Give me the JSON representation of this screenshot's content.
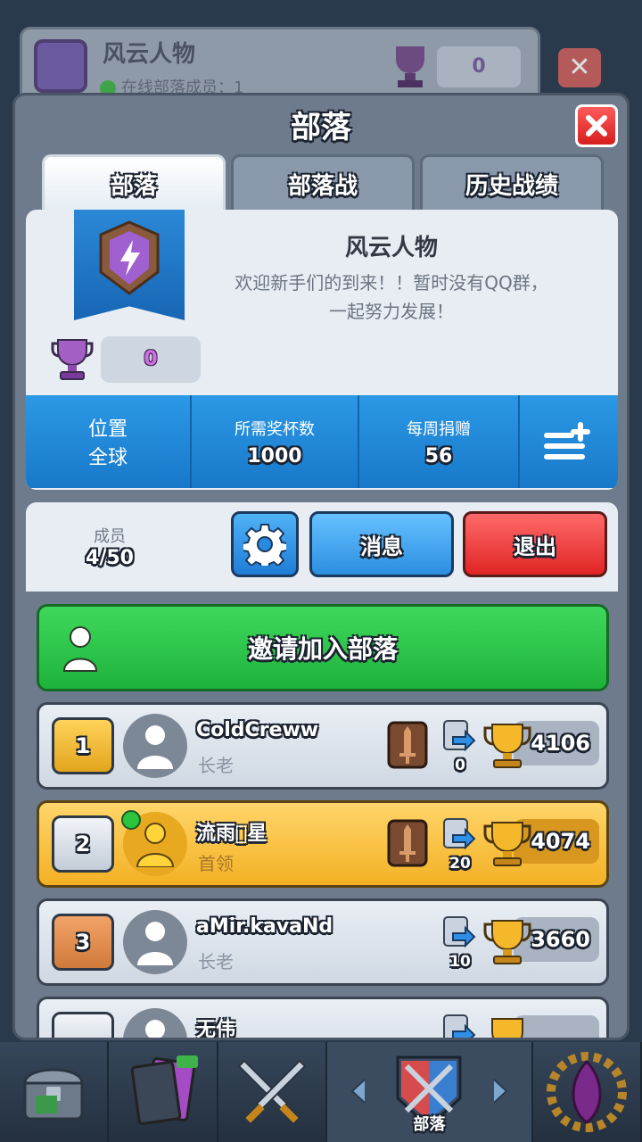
{
  "background_panel": {
    "clan_name": "风云人物",
    "online_text": "在线部落成员：1",
    "trophies": "0"
  },
  "modal": {
    "title": "部落",
    "tabs": [
      {
        "label": "部落",
        "active": true
      },
      {
        "label": "部落战",
        "active": false
      },
      {
        "label": "历史战绩",
        "active": false
      }
    ]
  },
  "clan": {
    "name": "风云人物",
    "description_line1": "欢迎新手们的到来！！暂时没有QQ群，",
    "description_line2": "一起努力发展！",
    "trophies": "0"
  },
  "stats": {
    "location_label": "位置",
    "location_value": "全球",
    "required_label": "所需奖杯数",
    "required_value": "1000",
    "donations_label": "每周捐赠",
    "donations_value": "56"
  },
  "members_bar": {
    "label": "成员",
    "count": "4/50",
    "message_label": "消息",
    "exit_label": "退出"
  },
  "invite_label": "邀请加入部落",
  "members": [
    {
      "rank": "1",
      "name": "ColdCreww",
      "role": "长老",
      "donations": "0",
      "trophies": "4106",
      "online": false,
      "is_me": false,
      "has_sword": true
    },
    {
      "rank": "2",
      "name": "流雨\u0000星",
      "role": "首领",
      "donations": "20",
      "trophies": "4074",
      "online": true,
      "is_me": true,
      "has_sword": true
    },
    {
      "rank": "3",
      "name": "aMir.kavaNd",
      "role": "长老",
      "donations": "10",
      "trophies": "3660",
      "online": false,
      "is_me": false,
      "has_sword": false
    },
    {
      "rank": "4",
      "name": "无伟",
      "role": "",
      "donations": "",
      "trophies": "",
      "online": false,
      "is_me": false,
      "has_sword": false
    }
  ],
  "nav": {
    "active_label": "部落"
  },
  "colors": {
    "tab_active": "#ffffff",
    "stats_blue": "#2b99e6",
    "invite_green": "#2fc94b",
    "exit_red": "#e02424",
    "me_row_gold": "#f3b124"
  }
}
